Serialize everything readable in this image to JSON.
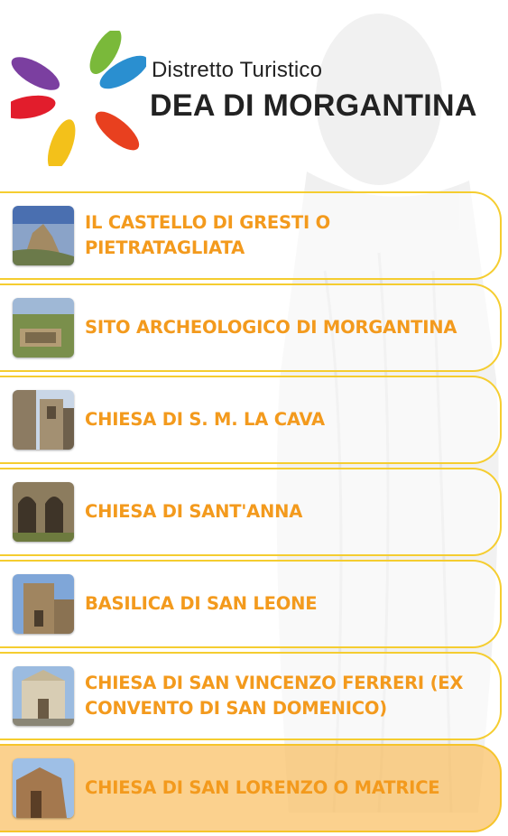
{
  "header": {
    "logo_line1": "Distretto Turistico",
    "logo_line2": "DEA DI MORGANTINA",
    "logo_icon": "wheat-wreath-logo"
  },
  "colors": {
    "accent_border": "#f5cd30",
    "label_text": "#f39a1d",
    "active_bg": "#fac46e"
  },
  "sites": [
    {
      "label": "IL CASTELLO DI GRESTI O PIETRATAGLIATA",
      "thumb": "castle-photo"
    },
    {
      "label": "SITO ARCHEOLOGICO DI MORGANTINA",
      "thumb": "ruins-photo"
    },
    {
      "label": "CHIESA DI S. M. LA CAVA",
      "thumb": "church-street-photo"
    },
    {
      "label": "CHIESA DI SANT'ANNA",
      "thumb": "arches-photo"
    },
    {
      "label": "BASILICA DI SAN LEONE",
      "thumb": "basilica-photo"
    },
    {
      "label": "CHIESA DI SAN VINCENZO FERRERI (EX CONVENTO DI SAN DOMENICO)",
      "thumb": "convent-photo"
    },
    {
      "label": "CHIESA DI SAN LORENZO O MATRICE",
      "thumb": "matrice-photo"
    }
  ]
}
